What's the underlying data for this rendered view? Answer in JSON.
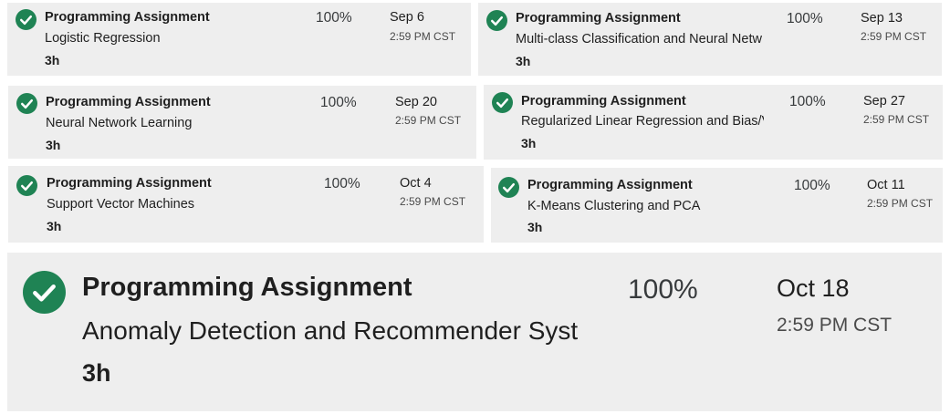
{
  "theme": {
    "card_background": "#eeeeee",
    "check_color": "#1f8354"
  },
  "assignments": [
    {
      "type": "Programming Assignment",
      "name": "Logistic Regression",
      "duration": "3h",
      "grade": "100%",
      "due_date": "Sep 6",
      "due_time": "2:59 PM CST",
      "status_icon": "check-circle-icon"
    },
    {
      "type": "Programming Assignment",
      "name": "Multi-class Classification and Neural Networks",
      "duration": "3h",
      "grade": "100%",
      "due_date": "Sep 13",
      "due_time": "2:59 PM CST",
      "status_icon": "check-circle-icon"
    },
    {
      "type": "Programming Assignment",
      "name": "Neural Network Learning",
      "duration": "3h",
      "grade": "100%",
      "due_date": "Sep 20",
      "due_time": "2:59 PM CST",
      "status_icon": "check-circle-icon"
    },
    {
      "type": "Programming Assignment",
      "name": "Regularized Linear Regression and Bias/Variance",
      "duration": "3h",
      "grade": "100%",
      "due_date": "Sep 27",
      "due_time": "2:59 PM CST",
      "status_icon": "check-circle-icon"
    },
    {
      "type": "Programming Assignment",
      "name": "Support Vector Machines",
      "duration": "3h",
      "grade": "100%",
      "due_date": "Oct 4",
      "due_time": "2:59 PM CST",
      "status_icon": "check-circle-icon"
    },
    {
      "type": "Programming Assignment",
      "name": "K-Means Clustering and PCA",
      "duration": "3h",
      "grade": "100%",
      "due_date": "Oct 11",
      "due_time": "2:59 PM CST",
      "status_icon": "check-circle-icon"
    },
    {
      "type": "Programming Assignment",
      "name": "Anomaly Detection and Recommender Systems",
      "duration": "3h",
      "grade": "100%",
      "due_date": "Oct 18",
      "due_time": "2:59 PM CST",
      "status_icon": "check-circle-icon"
    }
  ]
}
